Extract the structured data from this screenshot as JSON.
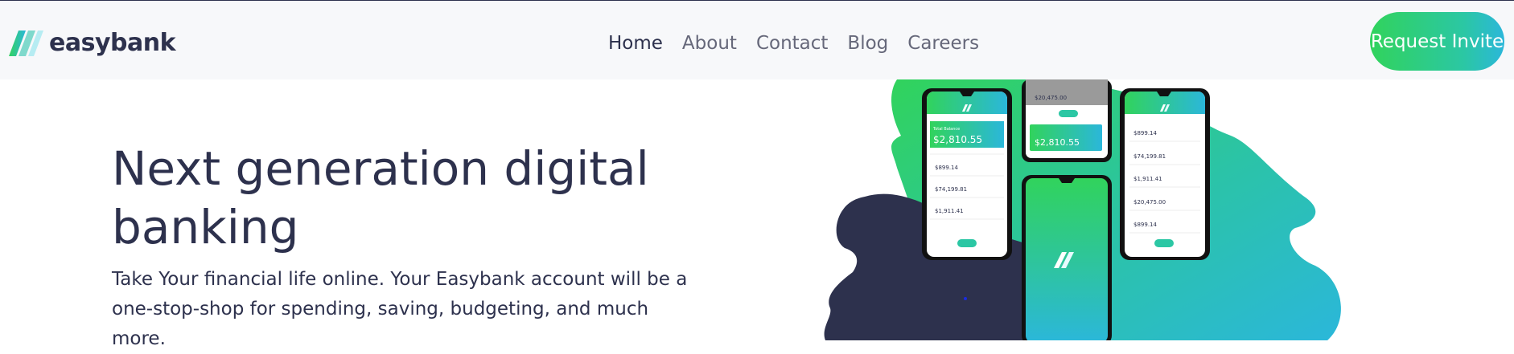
{
  "brand": {
    "name": "easybank",
    "logo_icon": "easybank-stripes-icon"
  },
  "nav": {
    "items": [
      {
        "label": "Home",
        "active": true
      },
      {
        "label": "About",
        "active": false
      },
      {
        "label": "Contact",
        "active": false
      },
      {
        "label": "Blog",
        "active": false
      },
      {
        "label": "Careers",
        "active": false
      }
    ],
    "cta_label": "Request Invite"
  },
  "hero": {
    "title": "Next generation digital banking",
    "text": "Take Your financial life online. Your Easybank account will be a one-stop-shop for spending, saving, budgeting, and much more."
  },
  "mockups": {
    "left_phone": {
      "balance_label": "Total Balance",
      "balance": "$2,810.55",
      "items": [
        "$899.14",
        "$74,199.81",
        "$1,911.41"
      ]
    },
    "top_phone": {
      "amount": "$20,475.00",
      "balance": "$2,810.55"
    },
    "right_phone": {
      "items": [
        "$899.14",
        "$74,199.81",
        "$1,911.41",
        "$20,475.00",
        "$899.14"
      ]
    }
  },
  "colors": {
    "dark_blue": "#2d314d",
    "lime_green": "#31d35c",
    "bright_cyan": "#2bb7da",
    "nav_text": "#66687a",
    "nav_bg": "#f7f8fa"
  }
}
